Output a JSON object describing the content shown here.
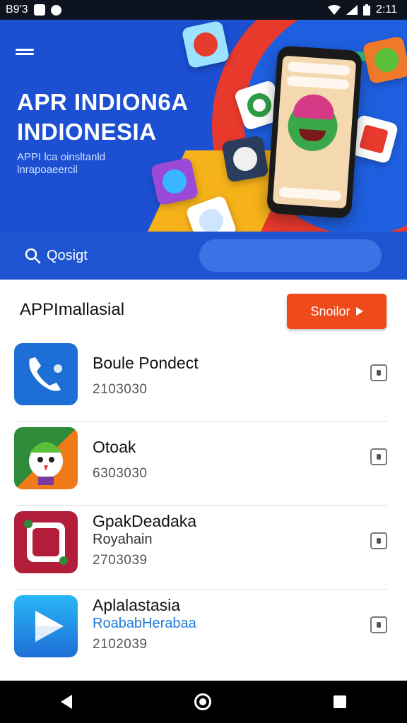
{
  "status_bar": {
    "left_text": "B9'3",
    "time": "2:11",
    "icons": [
      "picture-icon",
      "notification-icon",
      "wifi-icon",
      "signal-icon",
      "battery-icon"
    ]
  },
  "hero": {
    "title_line1": "APR INDION6A",
    "title_line2": "INDIONESIA",
    "subtitle_line1": "APPI lca oinsltanld",
    "subtitle_line2": "lnrapoaeercil"
  },
  "search": {
    "label": "Qosigt",
    "placeholder": ""
  },
  "section": {
    "title": "APPImallasial",
    "cta_label": "Snoilor"
  },
  "apps": [
    {
      "name": "Boule Pondect",
      "subtitle": "",
      "number": "2103030",
      "icon": "phone-icon",
      "color": "#1d6fd6"
    },
    {
      "name": "Otoak",
      "subtitle": "",
      "number": "6303030",
      "icon": "mascot-icon",
      "color": "#3aa84a"
    },
    {
      "name": "GpakDeadaka",
      "subtitle": "Royahain",
      "number": "2703039",
      "icon": "frame-icon",
      "color": "#b21e3a"
    },
    {
      "name": "Aplalastasia",
      "subtitle": "RoababHerabaa",
      "number": "2102039",
      "icon": "play-icon",
      "color": "#1e88e5"
    }
  ],
  "colors": {
    "hero_bg": "#1c4fd2",
    "accent": "#ef4a1a",
    "link_blue": "#1e7bd6"
  }
}
